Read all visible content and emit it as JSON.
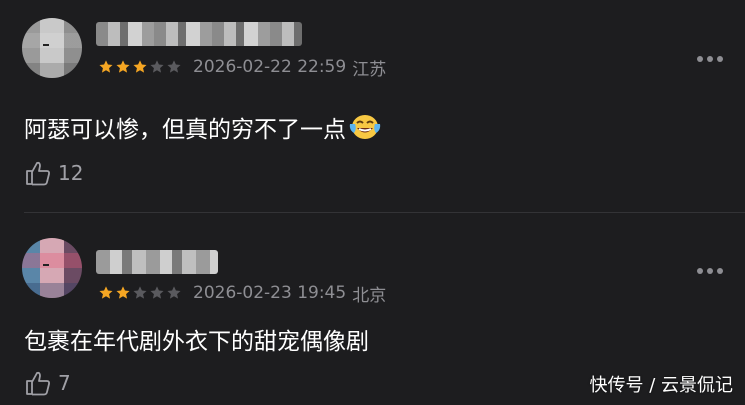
{
  "comments": [
    {
      "stars_filled": 3,
      "stars_total": 5,
      "date": "2026-02-22 22:59",
      "location": "江苏",
      "text": "阿瑟可以惨，但真的穷不了一点",
      "emoji": "laughing-tears",
      "likes": "12"
    },
    {
      "stars_filled": 2,
      "stars_total": 5,
      "date": "2026-02-23 19:45",
      "location": "北京",
      "text": "包裹在年代剧外衣下的甜宠偶像剧",
      "likes": "7"
    }
  ],
  "watermark": "快传号 / 云景侃记",
  "colors": {
    "background": "#1d1d1f",
    "star_filled": "#f5a623",
    "star_empty": "#5a5a5e",
    "meta_text": "#8e8e93"
  }
}
